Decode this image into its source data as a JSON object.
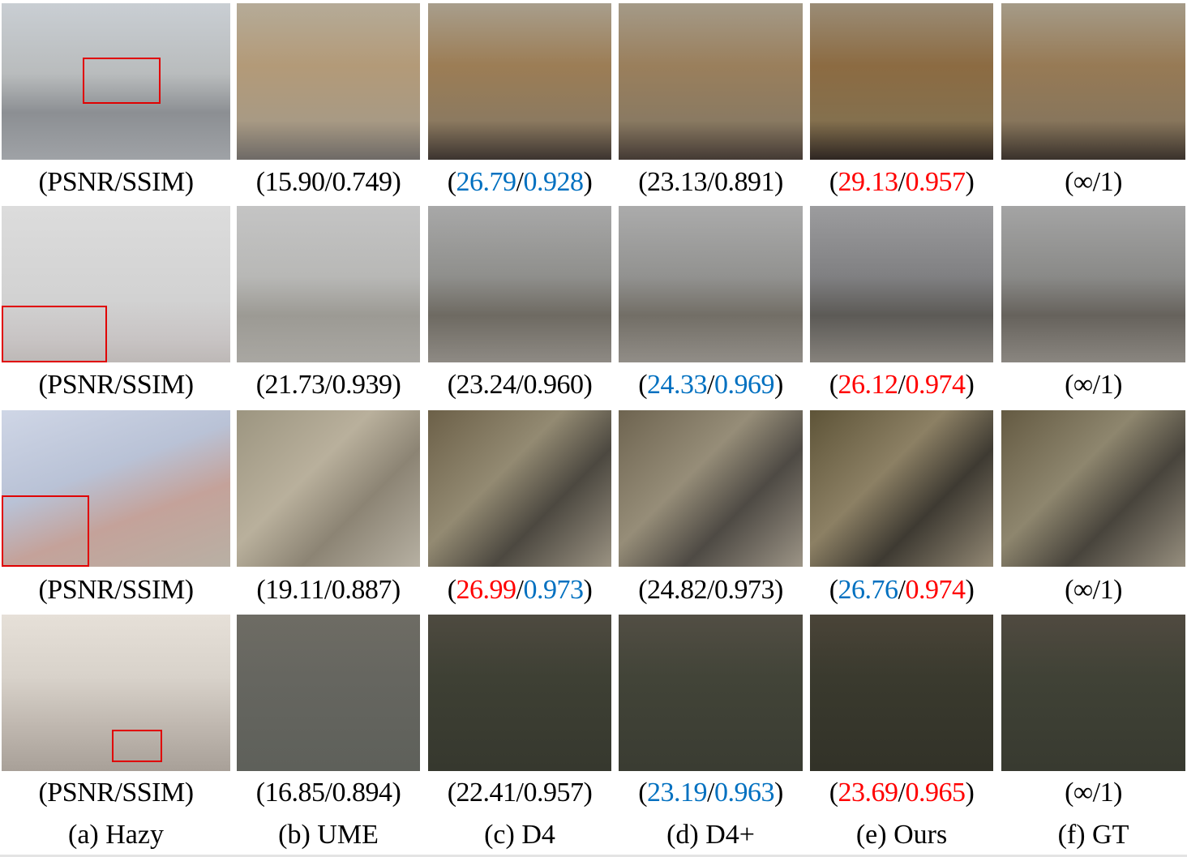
{
  "colors": {
    "best": "#ff0000",
    "second": "#0070c0",
    "normal": "#000000"
  },
  "column_labels": [
    "(a) Hazy",
    "(b) UME",
    "(c) D4",
    "(d) D4+",
    "(e) Ours",
    "(f) GT"
  ],
  "rows": [
    {
      "captions": [
        {
          "psnr": "PSNR",
          "ssim": "SSIM",
          "pc": "normal",
          "sc": "normal"
        },
        {
          "psnr": "15.90",
          "ssim": "0.749",
          "pc": "normal",
          "sc": "normal"
        },
        {
          "psnr": "26.79",
          "ssim": "0.928",
          "pc": "second",
          "sc": "second"
        },
        {
          "psnr": "23.13",
          "ssim": "0.891",
          "pc": "normal",
          "sc": "normal"
        },
        {
          "psnr": "29.13",
          "ssim": "0.957",
          "pc": "best",
          "sc": "best"
        },
        {
          "psnr": "∞",
          "ssim": "1",
          "pc": "normal",
          "sc": "normal"
        }
      ]
    },
    {
      "captions": [
        {
          "psnr": "PSNR",
          "ssim": "SSIM",
          "pc": "normal",
          "sc": "normal"
        },
        {
          "psnr": "21.73",
          "ssim": "0.939",
          "pc": "normal",
          "sc": "normal"
        },
        {
          "psnr": "23.24",
          "ssim": "0.960",
          "pc": "normal",
          "sc": "normal"
        },
        {
          "psnr": "24.33",
          "ssim": "0.969",
          "pc": "second",
          "sc": "second"
        },
        {
          "psnr": "26.12",
          "ssim": "0.974",
          "pc": "best",
          "sc": "best"
        },
        {
          "psnr": "∞",
          "ssim": "1",
          "pc": "normal",
          "sc": "normal"
        }
      ]
    },
    {
      "captions": [
        {
          "psnr": "PSNR",
          "ssim": "SSIM",
          "pc": "normal",
          "sc": "normal"
        },
        {
          "psnr": "19.11",
          "ssim": "0.887",
          "pc": "normal",
          "sc": "normal"
        },
        {
          "psnr": "26.99",
          "ssim": "0.973",
          "pc": "best",
          "sc": "second"
        },
        {
          "psnr": "24.82",
          "ssim": "0.973",
          "pc": "normal",
          "sc": "normal"
        },
        {
          "psnr": "26.76",
          "ssim": "0.974",
          "pc": "second",
          "sc": "best"
        },
        {
          "psnr": "∞",
          "ssim": "1",
          "pc": "normal",
          "sc": "normal"
        }
      ]
    },
    {
      "captions": [
        {
          "psnr": "PSNR",
          "ssim": "SSIM",
          "pc": "normal",
          "sc": "normal"
        },
        {
          "psnr": "16.85",
          "ssim": "0.894",
          "pc": "normal",
          "sc": "normal"
        },
        {
          "psnr": "22.41",
          "ssim": "0.957",
          "pc": "normal",
          "sc": "normal"
        },
        {
          "psnr": "23.19",
          "ssim": "0.963",
          "pc": "second",
          "sc": "second"
        },
        {
          "psnr": "23.69",
          "ssim": "0.965",
          "pc": "best",
          "sc": "best"
        },
        {
          "psnr": "∞",
          "ssim": "1",
          "pc": "normal",
          "sc": "normal"
        }
      ]
    }
  ]
}
